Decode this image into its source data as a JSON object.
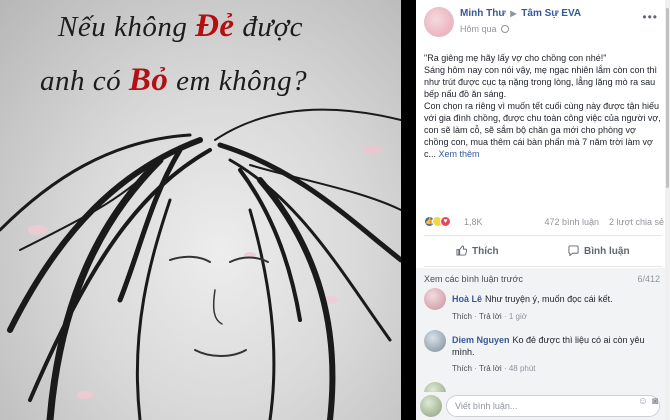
{
  "photo": {
    "line1_pre": "Nếu không ",
    "line1_red": "Đẻ",
    "line1_post": " được",
    "line2_pre": "anh có ",
    "line2_red": "Bỏ",
    "line2_post": " em không?"
  },
  "post": {
    "author": "Minh Thư",
    "arrow": "▶",
    "group": "Tâm Sự EVA",
    "time": "Hôm qua",
    "paragraphs": [
      "\"Ra giêng mẹ hãy lấy vợ cho chồng con nhé!\"",
      "Sáng hôm nay con nói vậy, mẹ ngạc nhiên lắm còn con thì như trút được cục tạ nặng trong lòng, lẳng lặng mò ra sau bếp nấu đồ ăn sáng.",
      "Con chọn ra riêng vì muốn tết cuối cùng này được tận hiếu với gia đình chồng, được chu toàn công việc của người vợ, con sẽ làm cỗ, sẽ sắm bộ chăn ga mới cho phòng vợ chồng con, mua thêm cái bàn phấn mà 7 năm trời làm vợ c..."
    ],
    "see_more": "Xem thêm",
    "reaction_count": "1,8K",
    "comments_count": "472 bình luận",
    "shares_count": "2 lượt chia sẻ",
    "like_label": "Thích",
    "comment_label": "Bình luận"
  },
  "comments": {
    "prev_label": "Xem các bình luận trước",
    "counter": "6/412",
    "items": [
      {
        "name": "Hoà Lê",
        "text": "Như truyện ý, muốn đọc cái kết.",
        "like": "Thích",
        "reply": "Trả lời",
        "time": "1 giờ"
      },
      {
        "name": "Diem Nguyen",
        "text": "Ko đẻ được thì liệu có ai còn yêu mình.",
        "like": "Thích",
        "reply": "Trả lời",
        "time": "48 phút"
      }
    ],
    "placeholder": "Viết bình luận..."
  },
  "colors": {
    "link": "#365899",
    "like": "#4267b2",
    "accent_red": "#b40f13"
  }
}
